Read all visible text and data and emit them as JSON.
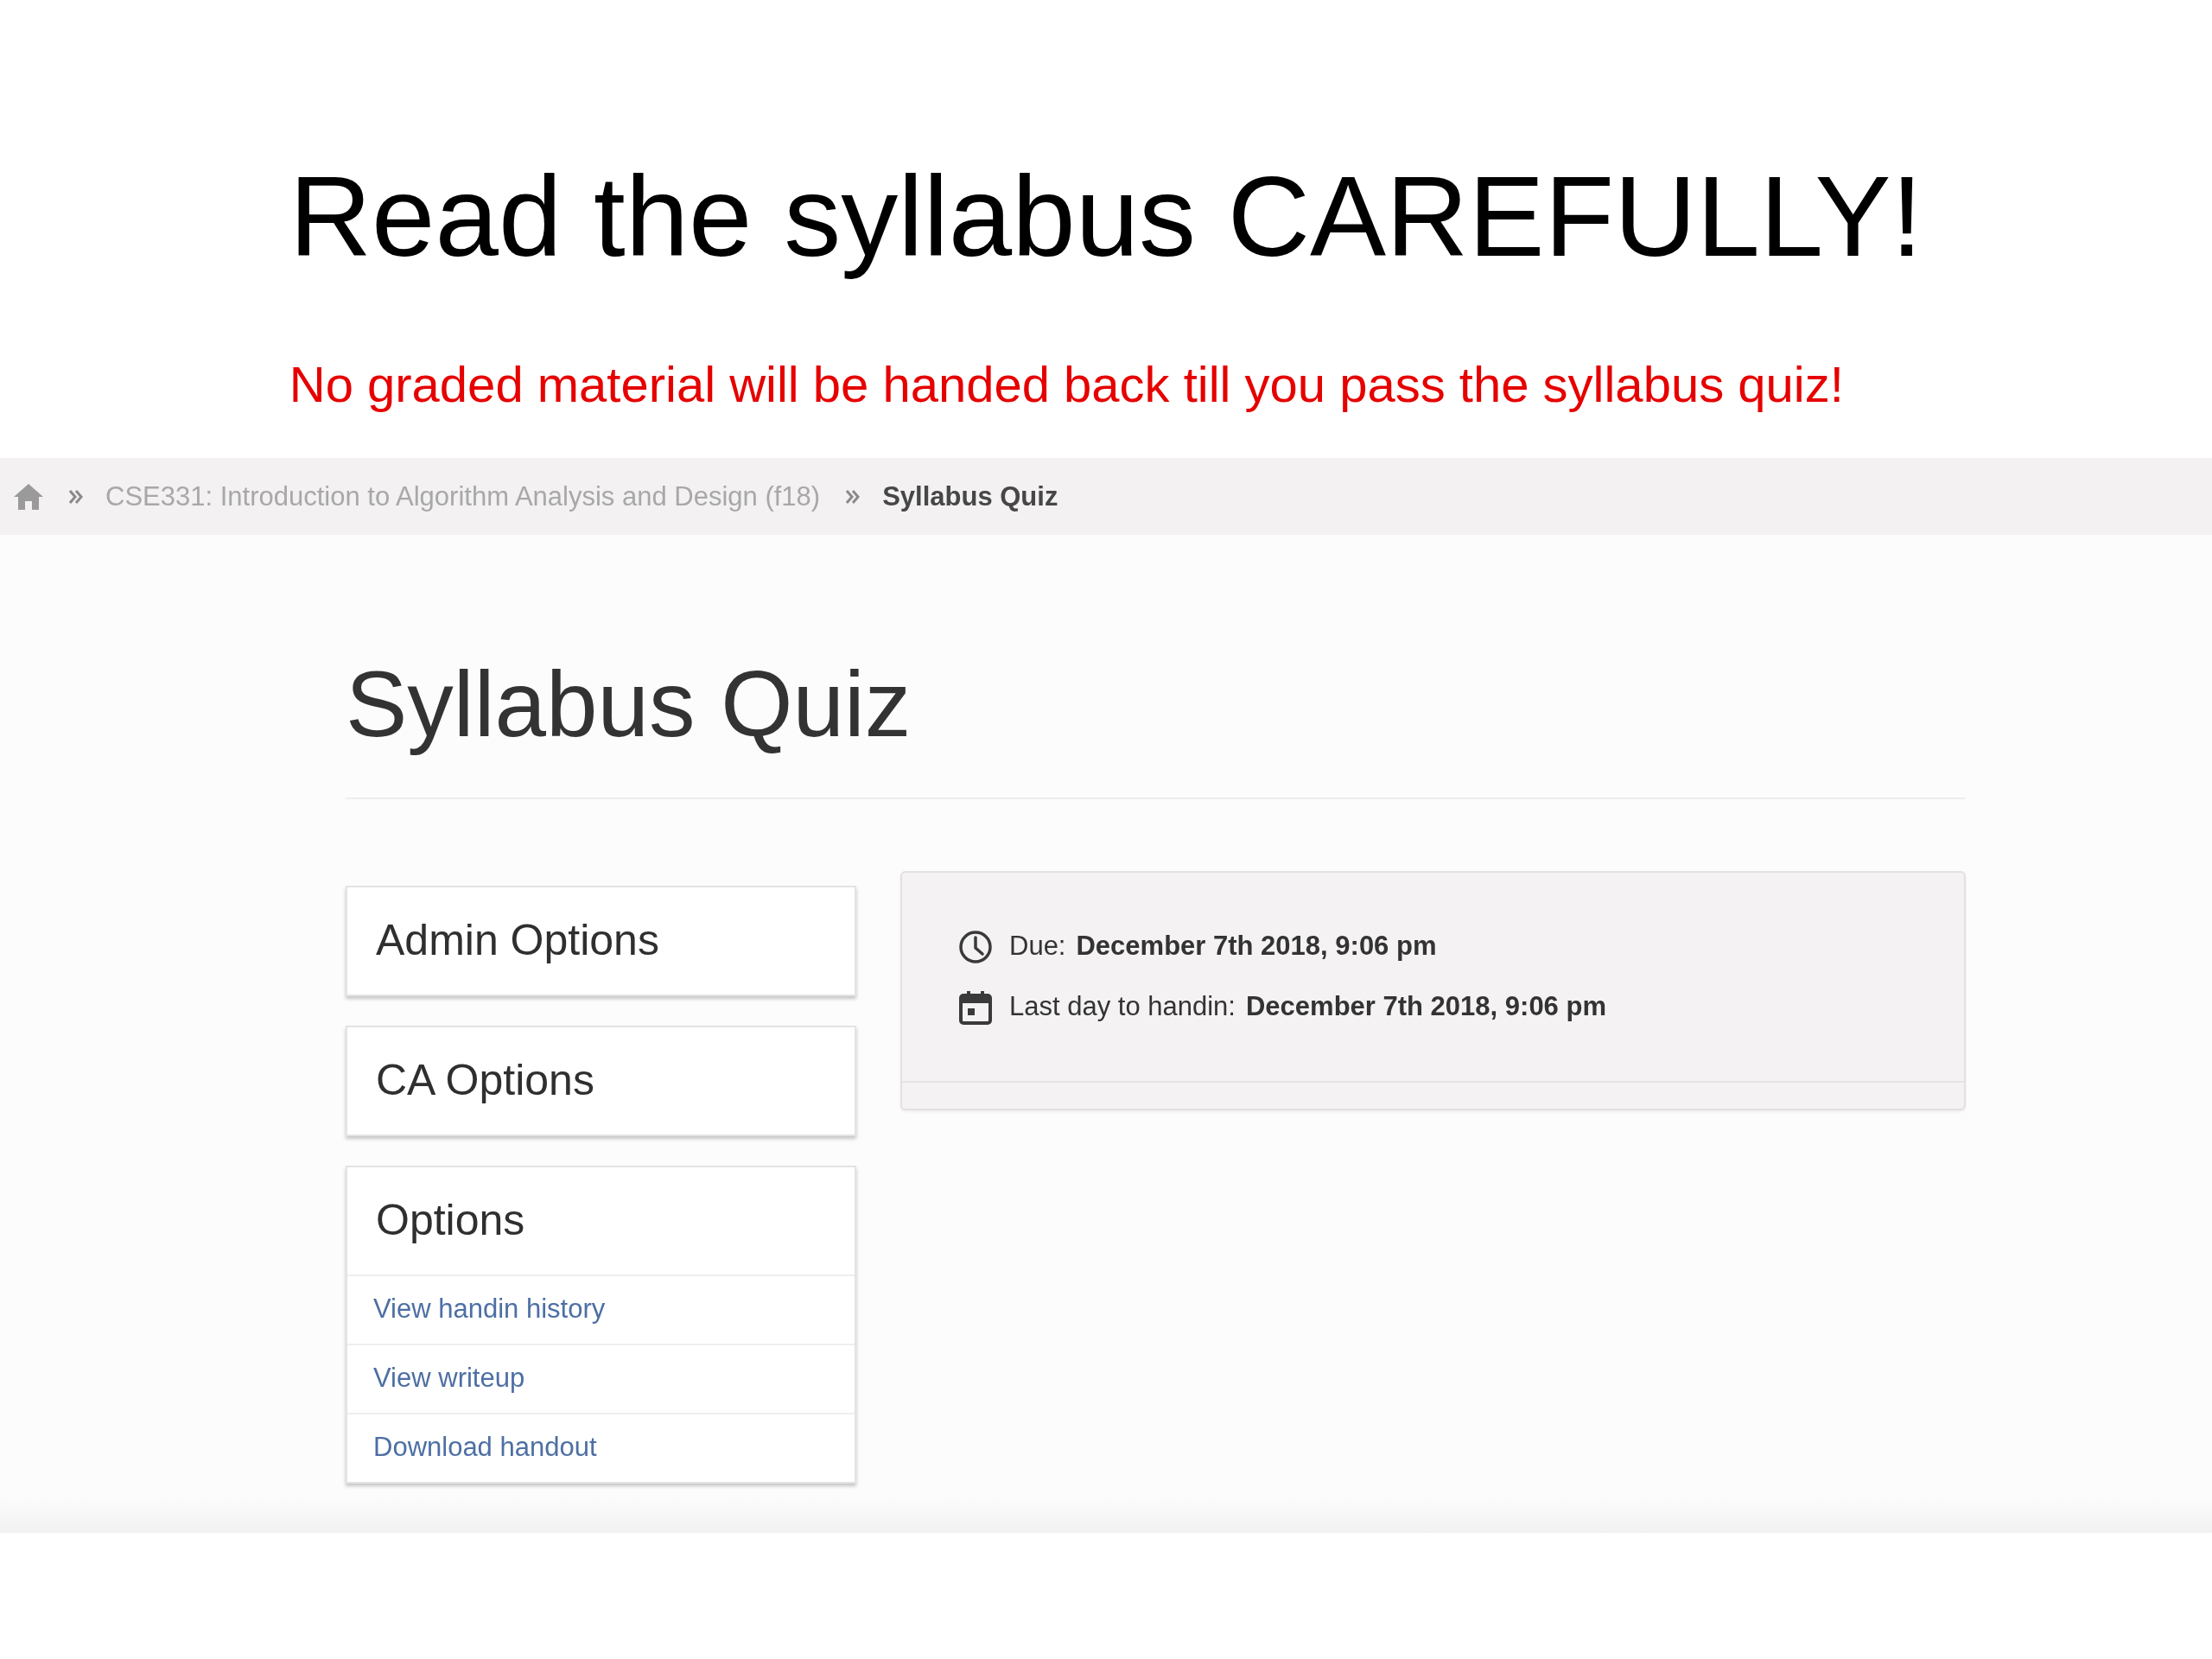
{
  "slide": {
    "title": "Read the syllabus CAREFULLY!",
    "subtitle": "No graded material will be handed back till you pass the syllabus quiz!"
  },
  "breadcrumb": {
    "items": [
      {
        "label": "CSE331: Introduction to Algorithm Analysis and Design (f18)",
        "current": false
      },
      {
        "label": "Syllabus Quiz",
        "current": true
      }
    ]
  },
  "page": {
    "heading": "Syllabus Quiz",
    "panels": [
      {
        "title": "Admin Options"
      },
      {
        "title": "CA Options"
      },
      {
        "title": "Options",
        "links": [
          "View handin history",
          "View writeup",
          "Download handout"
        ]
      }
    ],
    "info_card": {
      "dates": [
        {
          "kind": "due",
          "label": "Due:",
          "value": "December 7th 2018, 9:06 pm"
        },
        {
          "kind": "deadline",
          "label": "Last day to handin:",
          "value": "December 7th 2018, 9:06 pm"
        }
      ]
    }
  }
}
